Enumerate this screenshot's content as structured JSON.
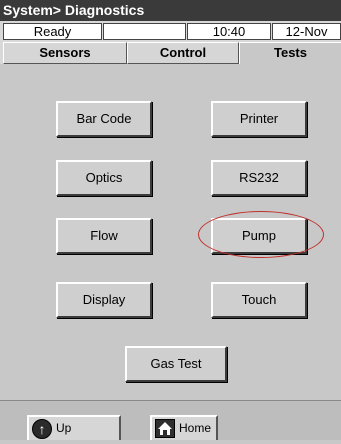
{
  "window": {
    "title": "System> Diagnostics"
  },
  "status": {
    "state": "Ready",
    "field2": "",
    "time": "10:40",
    "date": "12-Nov"
  },
  "tabs": [
    {
      "label": "Sensors",
      "active": false
    },
    {
      "label": "Control",
      "active": false
    },
    {
      "label": "Tests",
      "active": true
    }
  ],
  "tests": {
    "bar_code": "Bar Code",
    "printer": "Printer",
    "optics": "Optics",
    "rs232": "RS232",
    "flow": "Flow",
    "pump": "Pump",
    "display": "Display",
    "touch": "Touch",
    "gas_test": "Gas Test"
  },
  "nav": {
    "up_label": "Up",
    "up_icon": "up-arrow-icon",
    "home_label": "Home",
    "home_icon": "home-icon"
  },
  "colors": {
    "highlight": "#c0302a",
    "titlebar": "#3a3a3a"
  }
}
